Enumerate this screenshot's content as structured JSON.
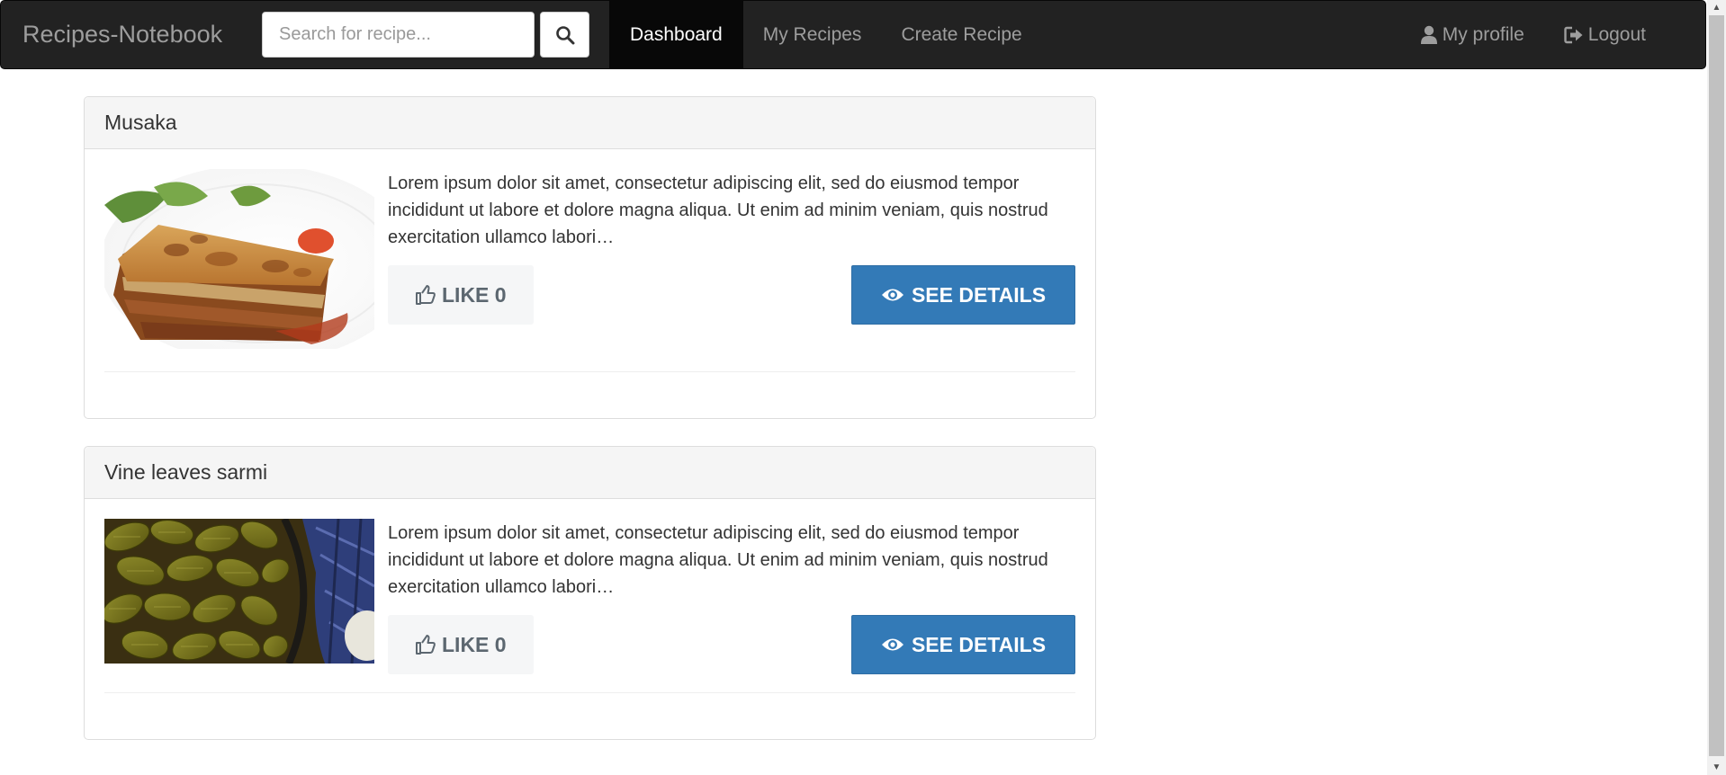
{
  "navbar": {
    "brand": "Recipes-Notebook",
    "search_placeholder": "Search for recipe...",
    "links": [
      {
        "label": "Dashboard",
        "active": true
      },
      {
        "label": "My Recipes",
        "active": false
      },
      {
        "label": "Create Recipe",
        "active": false
      }
    ],
    "profile_label": "My profile",
    "logout_label": "Logout"
  },
  "recipes": [
    {
      "title": "Musaka",
      "image": "musaka-photo",
      "description": "Lorem ipsum dolor sit amet, consectetur adipiscing elit, sed do eiusmod tempor incididunt ut labore et dolore magna aliqua. Ut enim ad minim veniam, quis nostrud exercitation ullamco labori…",
      "like_label": "LIKE 0",
      "details_label": "SEE DETAILS"
    },
    {
      "title": "Vine leaves sarmi",
      "image": "vine-leaves-sarmi-photo",
      "description": "Lorem ipsum dolor sit amet, consectetur adipiscing elit, sed do eiusmod tempor incididunt ut labore et dolore magna aliqua. Ut enim ad minim veniam, quis nostrud exercitation ullamco labori…",
      "like_label": "LIKE 0",
      "details_label": "SEE DETAILS"
    }
  ],
  "colors": {
    "navbar_bg": "#222222",
    "active_link_bg": "#080808",
    "primary": "#337ab7",
    "panel_heading_bg": "#f5f5f5"
  }
}
